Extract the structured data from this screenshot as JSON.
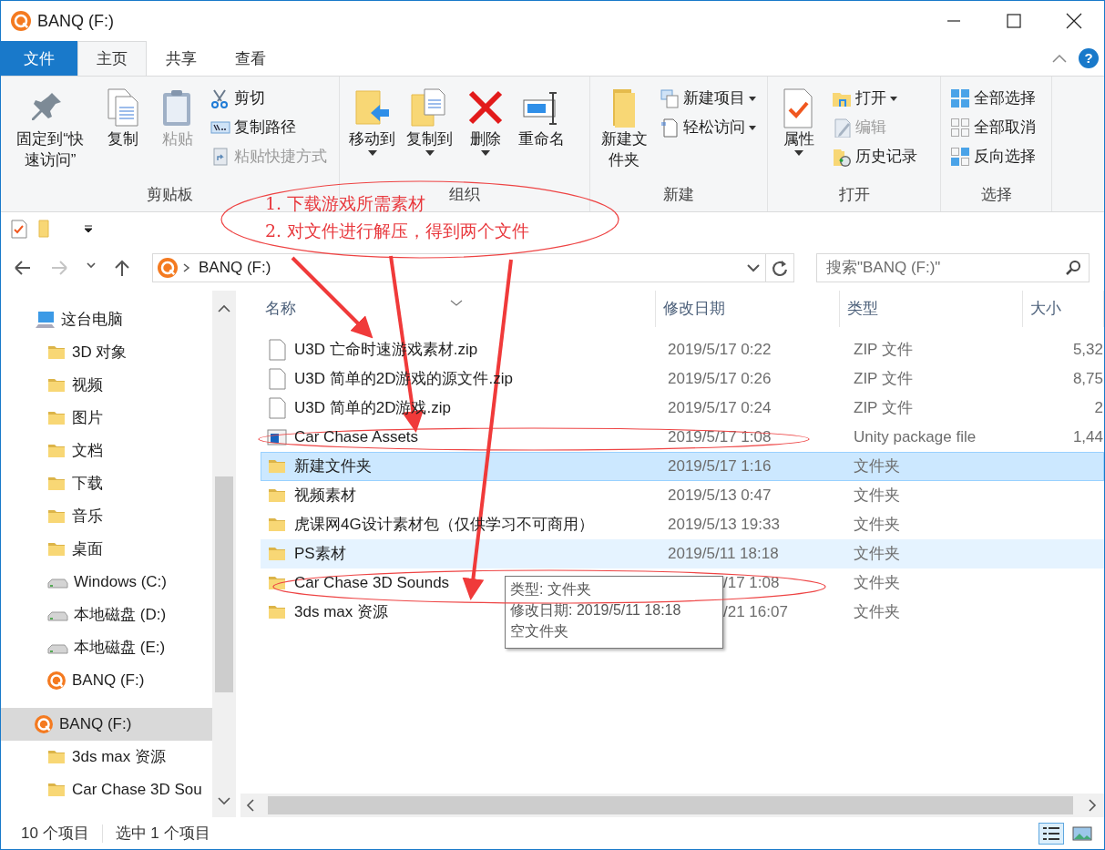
{
  "window": {
    "title": "BANQ (F:)"
  },
  "ribbon_tabs": [
    {
      "label": "文件",
      "kind": "file",
      "selected": false
    },
    {
      "label": "主页",
      "kind": "tab",
      "selected": true
    },
    {
      "label": "共享",
      "kind": "tab",
      "selected": false
    },
    {
      "label": "查看",
      "kind": "tab",
      "selected": false
    }
  ],
  "help": "?",
  "ribbon_groups": [
    {
      "label": "剪贴板",
      "buttons": [
        {
          "label": "固定到“快速访问”",
          "kind": "large",
          "disabled": false,
          "dropdown": false
        },
        {
          "label": "复制",
          "kind": "large",
          "disabled": false,
          "dropdown": false
        },
        {
          "label": "粘贴",
          "kind": "large",
          "disabled": true,
          "dropdown": false
        },
        {
          "label": "剪切",
          "kind": "small",
          "disabled": false,
          "dropdown": false
        },
        {
          "label": "复制路径",
          "kind": "small",
          "disabled": false,
          "dropdown": false
        },
        {
          "label": "粘贴快捷方式",
          "kind": "small",
          "disabled": true,
          "dropdown": false
        }
      ]
    },
    {
      "label": "组织",
      "buttons": [
        {
          "label": "移动到",
          "kind": "large",
          "disabled": false,
          "dropdown": true
        },
        {
          "label": "复制到",
          "kind": "large",
          "disabled": false,
          "dropdown": true
        },
        {
          "label": "删除",
          "kind": "large",
          "disabled": false,
          "dropdown": true
        },
        {
          "label": "重命名",
          "kind": "large",
          "disabled": false,
          "dropdown": false
        }
      ]
    },
    {
      "label": "新建",
      "buttons": [
        {
          "label": "新建文件夹",
          "kind": "large",
          "disabled": false,
          "dropdown": false
        },
        {
          "label": "新建项目",
          "kind": "small",
          "disabled": false,
          "dropdown": true
        },
        {
          "label": "轻松访问",
          "kind": "small",
          "disabled": false,
          "dropdown": true
        }
      ]
    },
    {
      "label": "打开",
      "buttons": [
        {
          "label": "属性",
          "kind": "large",
          "disabled": false,
          "dropdown": true
        },
        {
          "label": "打开",
          "kind": "small",
          "disabled": false,
          "dropdown": true
        },
        {
          "label": "编辑",
          "kind": "small",
          "disabled": true,
          "dropdown": false
        },
        {
          "label": "历史记录",
          "kind": "small",
          "disabled": false,
          "dropdown": false
        }
      ]
    },
    {
      "label": "选择",
      "buttons": [
        {
          "label": "全部选择",
          "kind": "small",
          "disabled": false,
          "dropdown": false
        },
        {
          "label": "全部取消",
          "kind": "small",
          "disabled": false,
          "dropdown": false
        },
        {
          "label": "反向选择",
          "kind": "small",
          "disabled": false,
          "dropdown": false
        }
      ]
    }
  ],
  "address": {
    "path": "BANQ (F:)"
  },
  "search": {
    "placeholder": "搜索\"BANQ (F:)\""
  },
  "nav_pane": [
    {
      "label": "这台电脑",
      "kind": "computer",
      "selected": false,
      "children": [
        {
          "label": "3D 对象",
          "kind": "folder",
          "selected": false
        },
        {
          "label": "视频",
          "kind": "folder",
          "selected": false
        },
        {
          "label": "图片",
          "kind": "folder",
          "selected": false
        },
        {
          "label": "文档",
          "kind": "folder",
          "selected": false
        },
        {
          "label": "下载",
          "kind": "folder",
          "selected": false
        },
        {
          "label": "音乐",
          "kind": "folder",
          "selected": false
        },
        {
          "label": "桌面",
          "kind": "folder",
          "selected": false
        },
        {
          "label": "Windows (C:)",
          "kind": "drive",
          "selected": false
        },
        {
          "label": "本地磁盘 (D:)",
          "kind": "drive",
          "selected": false
        },
        {
          "label": "本地磁盘 (E:)",
          "kind": "drive",
          "selected": false
        },
        {
          "label": "BANQ (F:)",
          "kind": "banq",
          "selected": false
        }
      ]
    },
    {
      "label": "BANQ (F:)",
      "kind": "banq",
      "selected": true,
      "children": [
        {
          "label": "3ds max 资源",
          "kind": "folder",
          "selected": false
        },
        {
          "label": "Car Chase 3D Sou",
          "kind": "folder",
          "selected": false
        }
      ]
    }
  ],
  "table": {
    "columns": [
      "名称",
      "修改日期",
      "类型",
      "大小"
    ],
    "rows": [
      {
        "name": "U3D 亡命时速游戏素材.zip",
        "date": "2019/5/17 0:22",
        "type": "ZIP 文件",
        "size": "5,32",
        "kind": "zip",
        "selected": false,
        "hovered": false,
        "covered": false
      },
      {
        "name": "U3D 简单的2D游戏的源文件.zip",
        "date": "2019/5/17 0:26",
        "type": "ZIP 文件",
        "size": "8,75",
        "kind": "zip",
        "selected": false,
        "hovered": false,
        "covered": false
      },
      {
        "name": "U3D 简单的2D游戏.zip",
        "date": "2019/5/17 0:24",
        "type": "ZIP 文件",
        "size": "2",
        "kind": "zip",
        "selected": false,
        "hovered": false,
        "covered": false
      },
      {
        "name": "Car Chase Assets",
        "date": "2019/5/17 1:08",
        "type": "Unity package file",
        "size": "1,44",
        "kind": "package",
        "selected": false,
        "hovered": false,
        "covered": false
      },
      {
        "name": "新建文件夹",
        "date": "2019/5/17 1:16",
        "type": "文件夹",
        "kind": "folder",
        "selected": true,
        "hovered": false,
        "covered": false
      },
      {
        "name": "视频素材",
        "date": "2019/5/13 0:47",
        "type": "文件夹",
        "kind": "folder",
        "selected": false,
        "hovered": false,
        "covered": false
      },
      {
        "name": "虎课网4G设计素材包（仅供学习不可商用）",
        "date": "2019/5/13 19:33",
        "type": "文件夹",
        "kind": "folder",
        "selected": false,
        "hovered": false,
        "covered": false
      },
      {
        "name": "PS素材",
        "date": "2019/5/11 18:18",
        "type": "文件夹",
        "kind": "folder",
        "selected": false,
        "hovered": true,
        "covered": false
      },
      {
        "name": "Car Chase 3D Sounds",
        "date": "/17 1:08",
        "type": "文件夹",
        "kind": "folder",
        "selected": false,
        "hovered": false,
        "covered": true
      },
      {
        "name": "3ds max 资源",
        "date": "/21 16:07",
        "type": "文件夹",
        "kind": "folder",
        "selected": false,
        "hovered": false,
        "covered": true
      }
    ]
  },
  "tooltip": [
    "类型: 文件夹",
    "修改日期: 2019/5/11 18:18",
    "空文件夹"
  ],
  "status_bar": {
    "count": "10 个项目",
    "selection": "选中 1 个项目"
  },
  "annotations": [
    "1. 下载游戏所需素材",
    "2. 对文件进行解压，得到两个文件"
  ]
}
